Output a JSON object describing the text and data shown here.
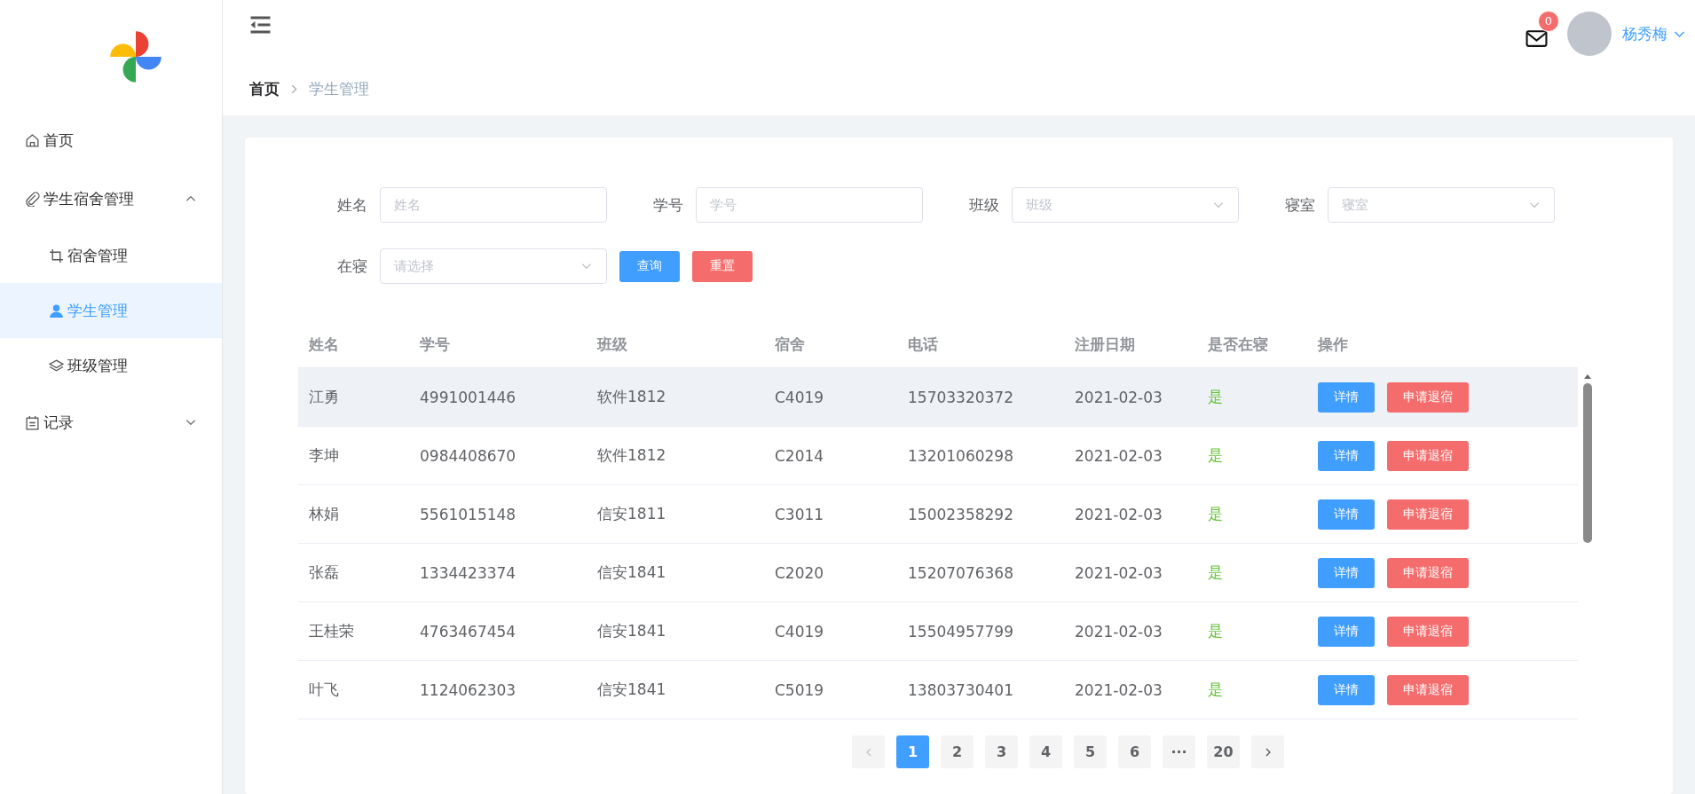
{
  "sidebar": {
    "items": [
      {
        "label": "首页",
        "selected": false
      },
      {
        "label": "学生宿舍管理",
        "expanded": true,
        "selected": false,
        "children": [
          {
            "label": "宿舍管理",
            "selected": false
          },
          {
            "label": "学生管理",
            "selected": true
          },
          {
            "label": "班级管理",
            "selected": false
          }
        ]
      },
      {
        "label": "记录",
        "expanded": false,
        "selected": false
      }
    ]
  },
  "header": {
    "notifications": "0",
    "user": "杨秀梅"
  },
  "breadcrumb": [
    {
      "label": "首页",
      "current": false
    },
    {
      "label": "学生管理",
      "current": true
    }
  ],
  "filters": [
    {
      "label": "姓名",
      "kind": "input",
      "placeholder": "姓名"
    },
    {
      "label": "学号",
      "kind": "input",
      "placeholder": "学号"
    },
    {
      "label": "班级",
      "kind": "select",
      "placeholder": "班级"
    },
    {
      "label": "寝室",
      "kind": "select",
      "placeholder": "寝室"
    },
    {
      "label": "在寝",
      "kind": "select",
      "placeholder": "请选择"
    }
  ],
  "filter_buttons": [
    {
      "label": "查询",
      "kind": "primary"
    },
    {
      "label": "重置",
      "kind": "danger"
    }
  ],
  "table": {
    "columns": [
      "姓名",
      "学号",
      "班级",
      "宿舍",
      "电话",
      "注册日期",
      "是否在寝",
      "操作"
    ],
    "rows": [
      {
        "selected": true,
        "cells": [
          "江勇",
          "4991001446",
          "软件1812",
          "C4019",
          "15703320372",
          "2021-02-03",
          "是"
        ],
        "actions": [
          "详情",
          "申请退宿"
        ]
      },
      {
        "selected": false,
        "cells": [
          "李坤",
          "0984408670",
          "软件1812",
          "C2014",
          "13201060298",
          "2021-02-03",
          "是"
        ],
        "actions": [
          "详情",
          "申请退宿"
        ]
      },
      {
        "selected": false,
        "cells": [
          "林娟",
          "5561015148",
          "信安1811",
          "C3011",
          "15002358292",
          "2021-02-03",
          "是"
        ],
        "actions": [
          "详情",
          "申请退宿"
        ]
      },
      {
        "selected": false,
        "cells": [
          "张磊",
          "1334423374",
          "信安1841",
          "C2020",
          "15207076368",
          "2021-02-03",
          "是"
        ],
        "actions": [
          "详情",
          "申请退宿"
        ]
      },
      {
        "selected": false,
        "cells": [
          "王桂荣",
          "4763467454",
          "信安1841",
          "C4019",
          "15504957799",
          "2021-02-03",
          "是"
        ],
        "actions": [
          "详情",
          "申请退宿"
        ]
      },
      {
        "selected": false,
        "cells": [
          "叶飞",
          "1124062303",
          "信安1841",
          "C5019",
          "13803730401",
          "2021-02-03",
          "是"
        ],
        "actions": [
          "详情",
          "申请退宿"
        ]
      }
    ]
  },
  "pagination": {
    "pages": [
      {
        "label": "1",
        "selected": true
      },
      {
        "label": "2",
        "selected": false
      },
      {
        "label": "3",
        "selected": false
      },
      {
        "label": "4",
        "selected": false
      },
      {
        "label": "5",
        "selected": false
      },
      {
        "label": "6",
        "selected": false
      },
      {
        "label": "···",
        "selected": false
      },
      {
        "label": "20",
        "selected": false
      }
    ]
  }
}
